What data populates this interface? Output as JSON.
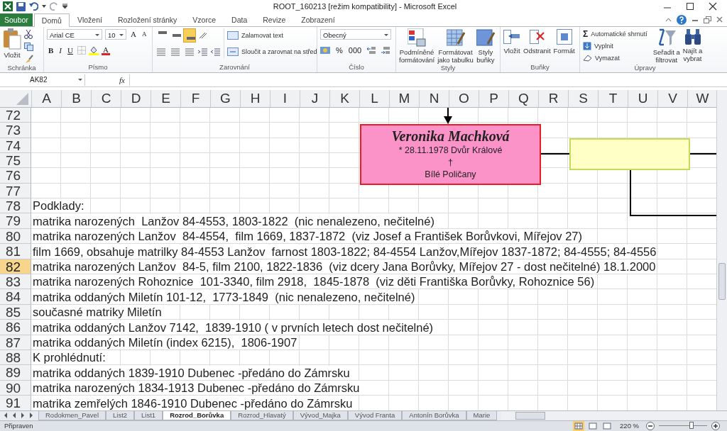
{
  "window": {
    "title": "ROOT_160213  [režim kompatibility]  -  Microsoft Excel"
  },
  "ribbon": {
    "file_tab": "Soubor",
    "tabs": [
      {
        "label": "Domů",
        "selected": true
      },
      {
        "label": "Vložení",
        "selected": false
      },
      {
        "label": "Rozložení stránky",
        "selected": false
      },
      {
        "label": "Vzorce",
        "selected": false
      },
      {
        "label": "Data",
        "selected": false
      },
      {
        "label": "Revize",
        "selected": false
      },
      {
        "label": "Zobrazení",
        "selected": false
      }
    ],
    "clipboard": {
      "label": "Schránka",
      "paste": "Vložit"
    },
    "font": {
      "label": "Písmo",
      "family": "Arial CE",
      "size": "10",
      "bold": "B",
      "italic": "I",
      "underline": "U",
      "grow": "A",
      "shrink": "A",
      "color_letter": "A"
    },
    "alignment": {
      "label": "Zarovnání",
      "vertical": [
        {
          "selected": false
        },
        {
          "selected": false
        },
        {
          "selected": true
        }
      ],
      "wrap": "Zalamovat text",
      "merge": "Sloučit a zarovnat na střed"
    },
    "number": {
      "label": "Číslo",
      "format": "Obecný",
      "percent": "%",
      "thousands": "000"
    },
    "styles": {
      "label": "Styly",
      "items": [
        {
          "line1": "Podmíněné",
          "line2": "formátování"
        },
        {
          "line1": "Formátovat",
          "line2": "jako tabulku"
        },
        {
          "line1": "Styly",
          "line2": "buňky"
        }
      ]
    },
    "cells": {
      "label": "Buňky",
      "items": [
        "Vložit",
        "Odstranit",
        "Formát"
      ]
    },
    "editing": {
      "label": "Úpravy",
      "sigma": "Σ",
      "autosum": "Automatické shrnutí",
      "fill": "Vyplnit",
      "clear": "Vymazat",
      "sort": {
        "line1": "Seřadit a",
        "line2": "filtrovat"
      },
      "find": {
        "line1": "Najít a",
        "line2": "vybrat"
      }
    }
  },
  "formula_bar": {
    "name_box": "AK82",
    "fx": "fx"
  },
  "sheet": {
    "columns": [
      "A",
      "B",
      "C",
      "D",
      "E",
      "F",
      "G",
      "H",
      "I",
      "J",
      "K",
      "L",
      "M",
      "N",
      "O",
      "P",
      "Q",
      "R",
      "S",
      "T",
      "U",
      "V",
      "W"
    ],
    "rows": [
      {
        "number": "72",
        "text": "",
        "selected": false
      },
      {
        "number": "73",
        "text": "",
        "selected": false
      },
      {
        "number": "74",
        "text": "",
        "selected": false
      },
      {
        "number": "75",
        "text": "",
        "selected": false
      },
      {
        "number": "76",
        "text": "",
        "selected": false
      },
      {
        "number": "77",
        "text": "",
        "selected": false
      },
      {
        "number": "78",
        "text": "Podklady:",
        "selected": false
      },
      {
        "number": "79",
        "text": "matrika narozených  Lanžov 84-4553, 1803-1822  (nic nenalezeno, nečitelné)",
        "selected": false
      },
      {
        "number": "80",
        "text": "matrika narozených Lanžov  84-4554,  film 1669, 1837-1872  (viz Josef a František Borůvkovi, Mířejov 27)",
        "selected": false
      },
      {
        "number": "81",
        "text": "film 1669, obsahuje matrilky 84-4553 Lanžov  farnost 1803-1822; 84-4554 Lanžov,Mířejov 1837-1872; 84-4555; 84-4556",
        "selected": false
      },
      {
        "number": "82",
        "text": "matrika narozených Lanžov  84-5, film 2100, 1822-1836  (viz dcery Jana Borůvky, Mířejov 27 - dost nečitelné) 18.1.2000",
        "selected": true
      },
      {
        "number": "83",
        "text": "matrika narozených Rohoznice  101-3340, film 2918,  1845-1878  (viz děti Františka Borůvky, Rohoznice 56)",
        "selected": false
      },
      {
        "number": "84",
        "text": "matrika oddaných Miletín 101-12,  1773-1849  (nic nenalezeno, nečitelné)",
        "selected": false
      },
      {
        "number": "85",
        "text": "současné matriky Miletín",
        "selected": false
      },
      {
        "number": "86",
        "text": "matrika oddaných Lanžov 7142,  1839-1910 ( v prvních letech dost nečitelné)",
        "selected": false
      },
      {
        "number": "87",
        "text": "matrika oddaných Miletín (index 6215),  1806-1907",
        "selected": false
      },
      {
        "number": "88",
        "text": "K prohlédnutí:",
        "selected": false
      },
      {
        "number": "89",
        "text": "matrika oddaných 1839-1910 Dubenec -předáno do Zámrsku",
        "selected": false
      },
      {
        "number": "90",
        "text": "matrika narozených 1834-1913 Dubenec -předáno do Zámrsku",
        "selected": false
      },
      {
        "number": "91",
        "text": "matrika zemřelých 1846-1910 Dubenec -předáno do Zámrsku",
        "selected": false
      }
    ],
    "cards": [
      {
        "kind": "person",
        "name": "Veronika Machková",
        "birth": "* 28.11.1978 Dvůr Králové",
        "death": "†",
        "place": "Bílé Poličany"
      },
      {
        "kind": "empty"
      }
    ]
  },
  "sheet_tabs": [
    {
      "label": "Rodokmen_Pavel",
      "selected": false
    },
    {
      "label": "List2",
      "selected": false
    },
    {
      "label": "List1",
      "selected": false
    },
    {
      "label": "Rozrod_Borůvka",
      "selected": true
    },
    {
      "label": "Rozrod_Hlavatý",
      "selected": false
    },
    {
      "label": "Vývod_Majka",
      "selected": false
    },
    {
      "label": "Vývod Franta",
      "selected": false
    },
    {
      "label": "Antonín Borůvka",
      "selected": false
    },
    {
      "label": "Marie",
      "selected": false
    }
  ],
  "status_bar": {
    "state": "Připraven",
    "views": [
      {
        "selected": true
      },
      {
        "selected": false
      },
      {
        "selected": false
      }
    ],
    "zoom": "220 %",
    "zoom_slider": {
      "level": 0.68
    }
  }
}
